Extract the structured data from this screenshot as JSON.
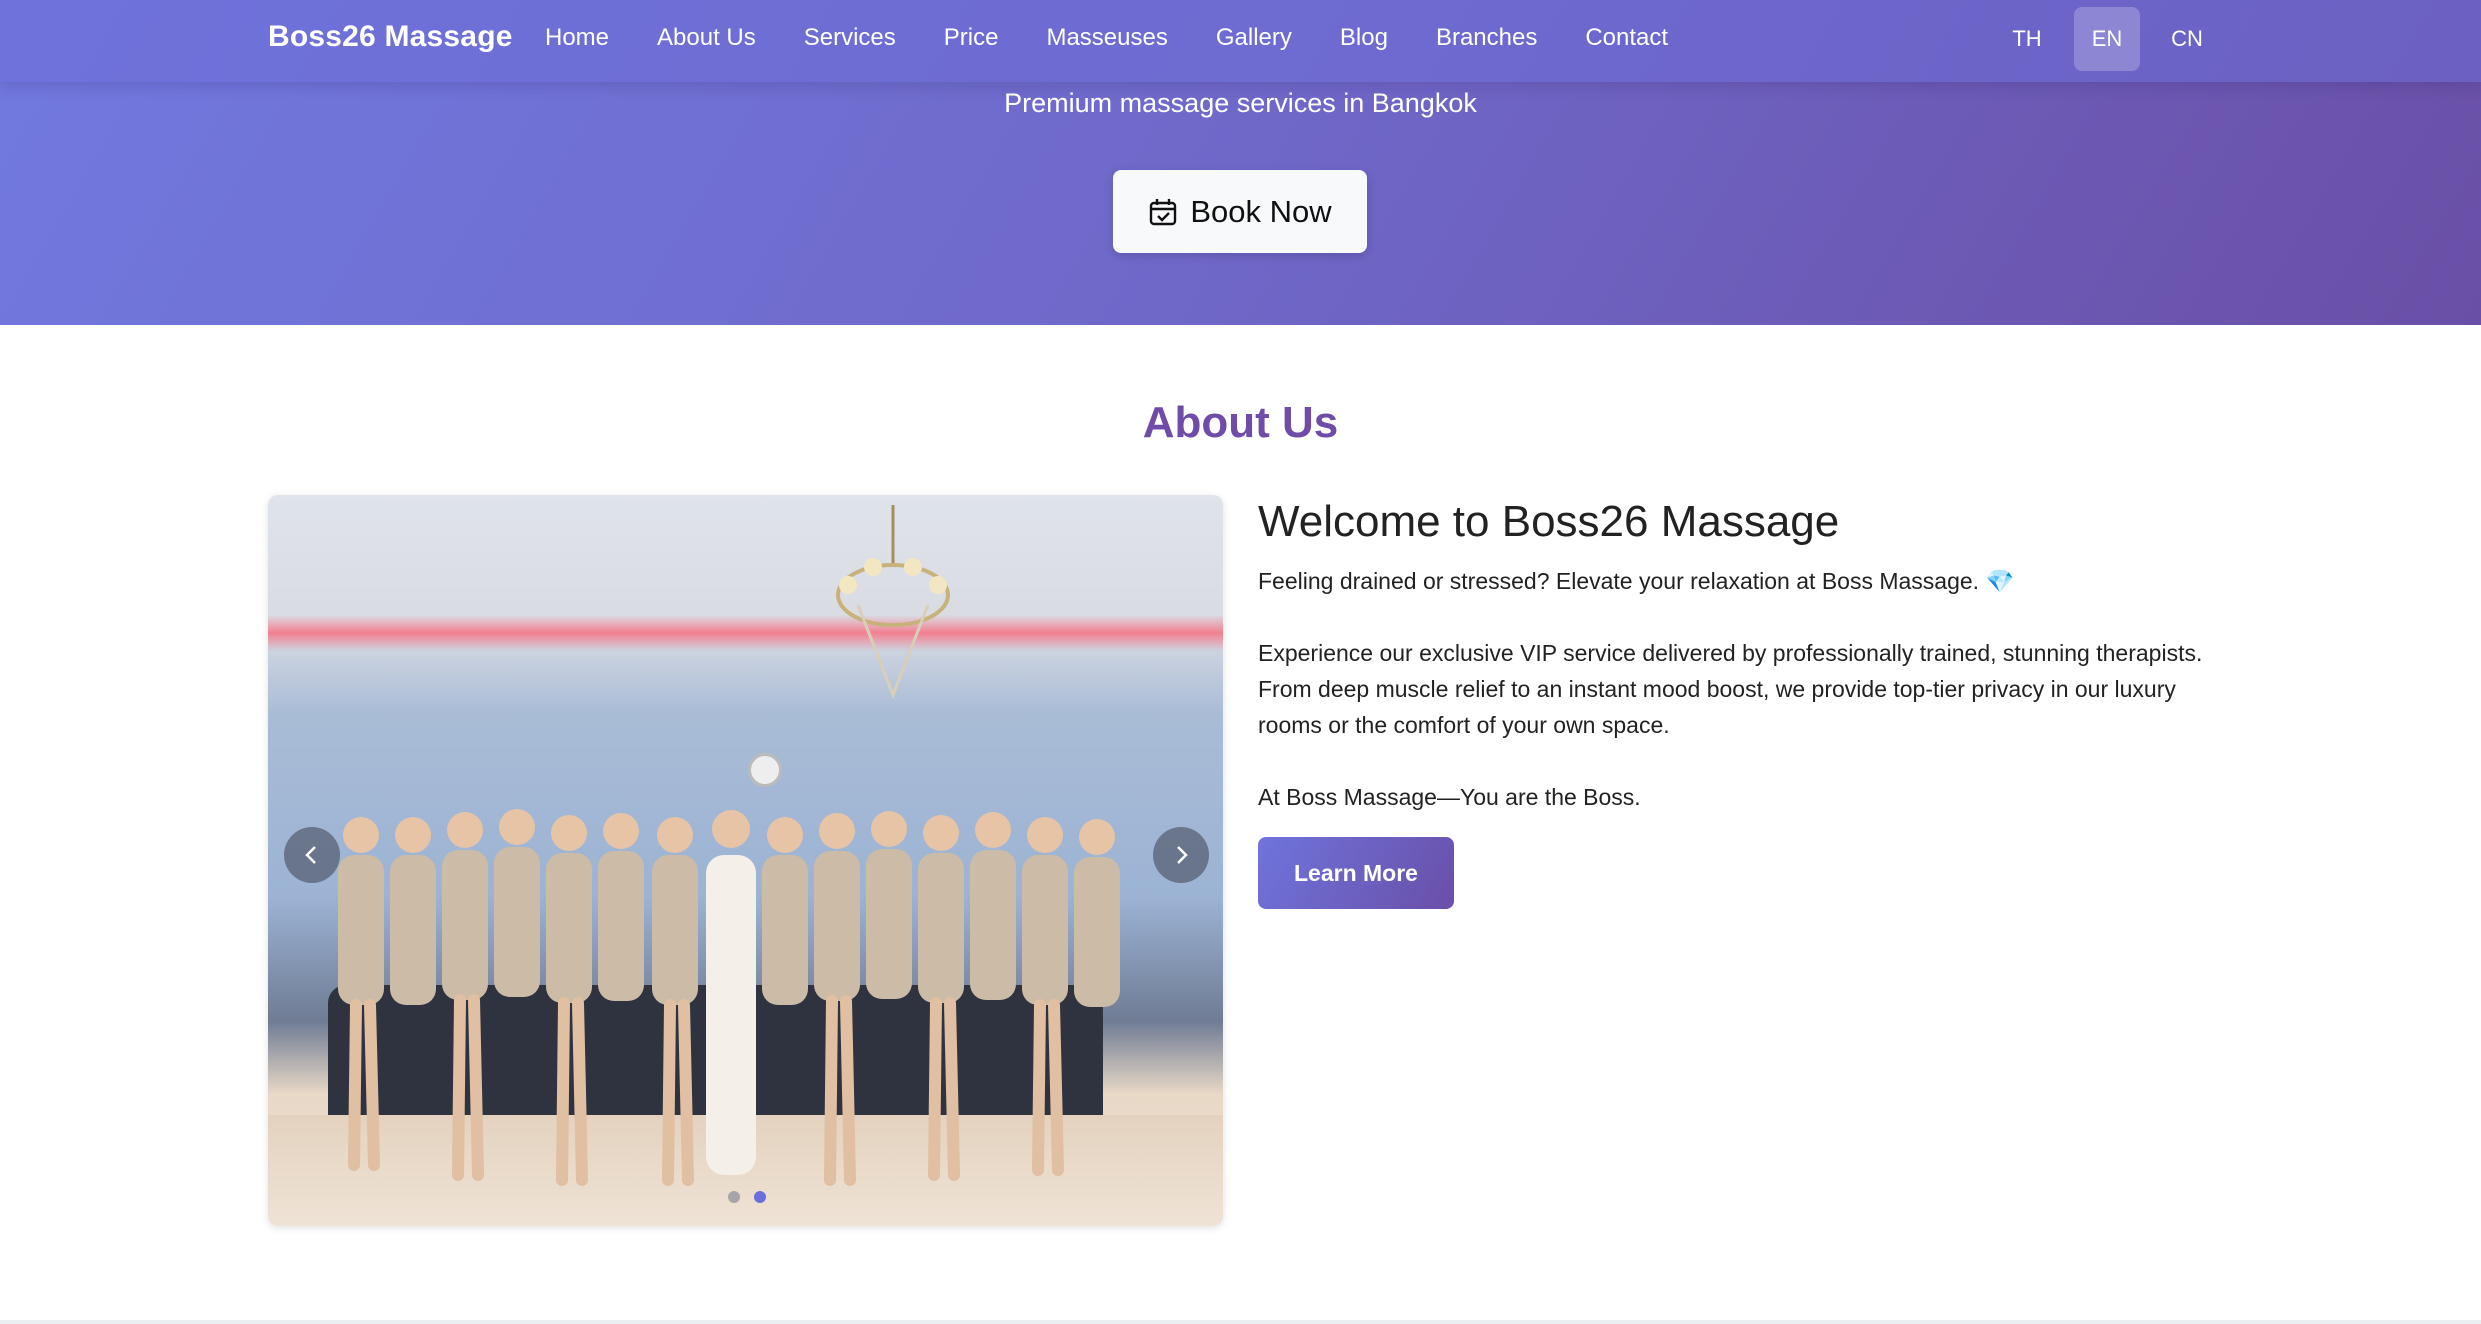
{
  "nav": {
    "brand": "Boss26 Massage",
    "links": [
      "Home",
      "About Us",
      "Services",
      "Price",
      "Masseuses",
      "Gallery",
      "Blog",
      "Branches",
      "Contact"
    ],
    "languages": [
      "TH",
      "EN",
      "CN"
    ],
    "active_language": "EN"
  },
  "hero": {
    "tagline": "Premium massage services in Bangkok",
    "book_label": "Book Now"
  },
  "about": {
    "section_title": "About Us",
    "heading": "Welcome to Boss26 Massage",
    "paragraphs": [
      "Feeling drained or stressed? Elevate your relaxation at Boss Massage. 💎",
      "Experience our exclusive VIP service delivered by professionally trained, stunning therapists. From deep muscle relief to an instant mood boost, we provide top-tier privacy in our luxury rooms or the comfort of your own space.",
      "At Boss Massage—You are the Boss."
    ],
    "learn_more_label": "Learn More",
    "carousel": {
      "slide_count": 2,
      "active_slide": 2
    }
  },
  "colors": {
    "accent_purple": "#6e4ca8",
    "gradient_start": "#7179df",
    "gradient_end": "#6a4fa6",
    "dot_active": "#6b6fdc"
  }
}
